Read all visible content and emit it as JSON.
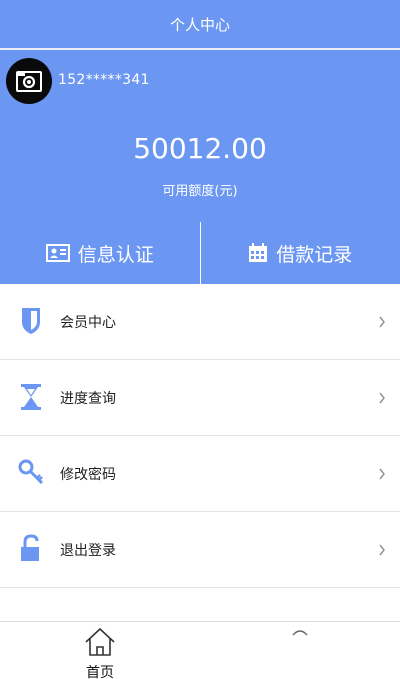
{
  "header": {
    "title": "个人中心"
  },
  "profile": {
    "phone": "152*****341"
  },
  "balance": {
    "amount": "50012.00",
    "label": "可用额度(元)"
  },
  "actions": [
    {
      "label": "信息认证",
      "icon": "id-card-icon"
    },
    {
      "label": "借款记录",
      "icon": "calendar-icon"
    }
  ],
  "menu": [
    {
      "label": "会员中心",
      "icon": "shield-icon"
    },
    {
      "label": "进度查询",
      "icon": "hourglass-icon"
    },
    {
      "label": "修改密码",
      "icon": "key-icon"
    },
    {
      "label": "退出登录",
      "icon": "unlock-icon"
    }
  ],
  "tabbar": [
    {
      "label": "首页",
      "icon": "home-icon"
    },
    {
      "label": "",
      "icon": "user-icon"
    }
  ],
  "colors": {
    "primary": "#6b97f3",
    "divider": "#e4e4e4"
  }
}
